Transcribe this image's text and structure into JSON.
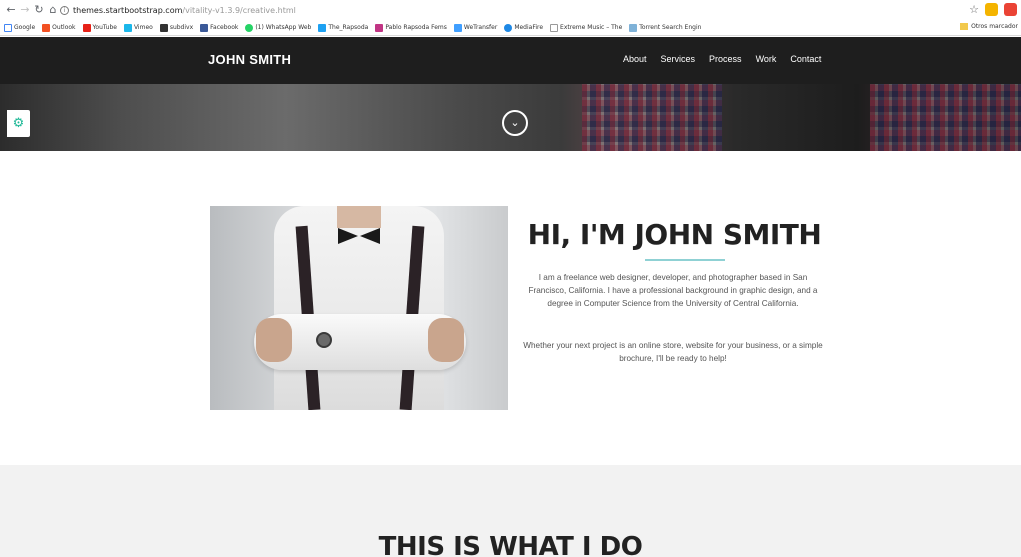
{
  "browser": {
    "url_host": "themes.startbootstrap.com",
    "url_path": "/vitality-v1.3.9/creative.html",
    "bookmarks": [
      "Google",
      "Outlook",
      "YouTube",
      "Vimeo",
      "subdivx",
      "Facebook",
      "(1) WhatsApp Web",
      "The_Rapsoda",
      "Pablo Rapsoda Fems",
      "WeTransfer",
      "MediaFire",
      "Extreme Music – The",
      "Torrent Search Engin"
    ],
    "other_bookmarks": "Otros marcador"
  },
  "nav": {
    "brand": "JOHN SMITH",
    "links": [
      "About",
      "Services",
      "Process",
      "Work",
      "Contact"
    ]
  },
  "about": {
    "title": "HI, I'M JOHN SMITH",
    "paragraph1": "I am a freelance web designer, developer, and photographer based in San Francisco, California. I have a professional background in graphic design, and a degree in Computer Science from the University of Central California.",
    "paragraph2": "Whether your next project is an online store, website for your business, or a simple brochure, I'll be ready to help!"
  },
  "services": {
    "title": "THIS IS WHAT I DO"
  },
  "colors": {
    "accent": "#1db896",
    "nav_bg": "#1e1e1e",
    "divider": "#8fd1d4",
    "section_bg": "#f2f2f2"
  },
  "icons": {
    "down": "chevron-down-circle-icon",
    "settings": "gear-icon"
  }
}
